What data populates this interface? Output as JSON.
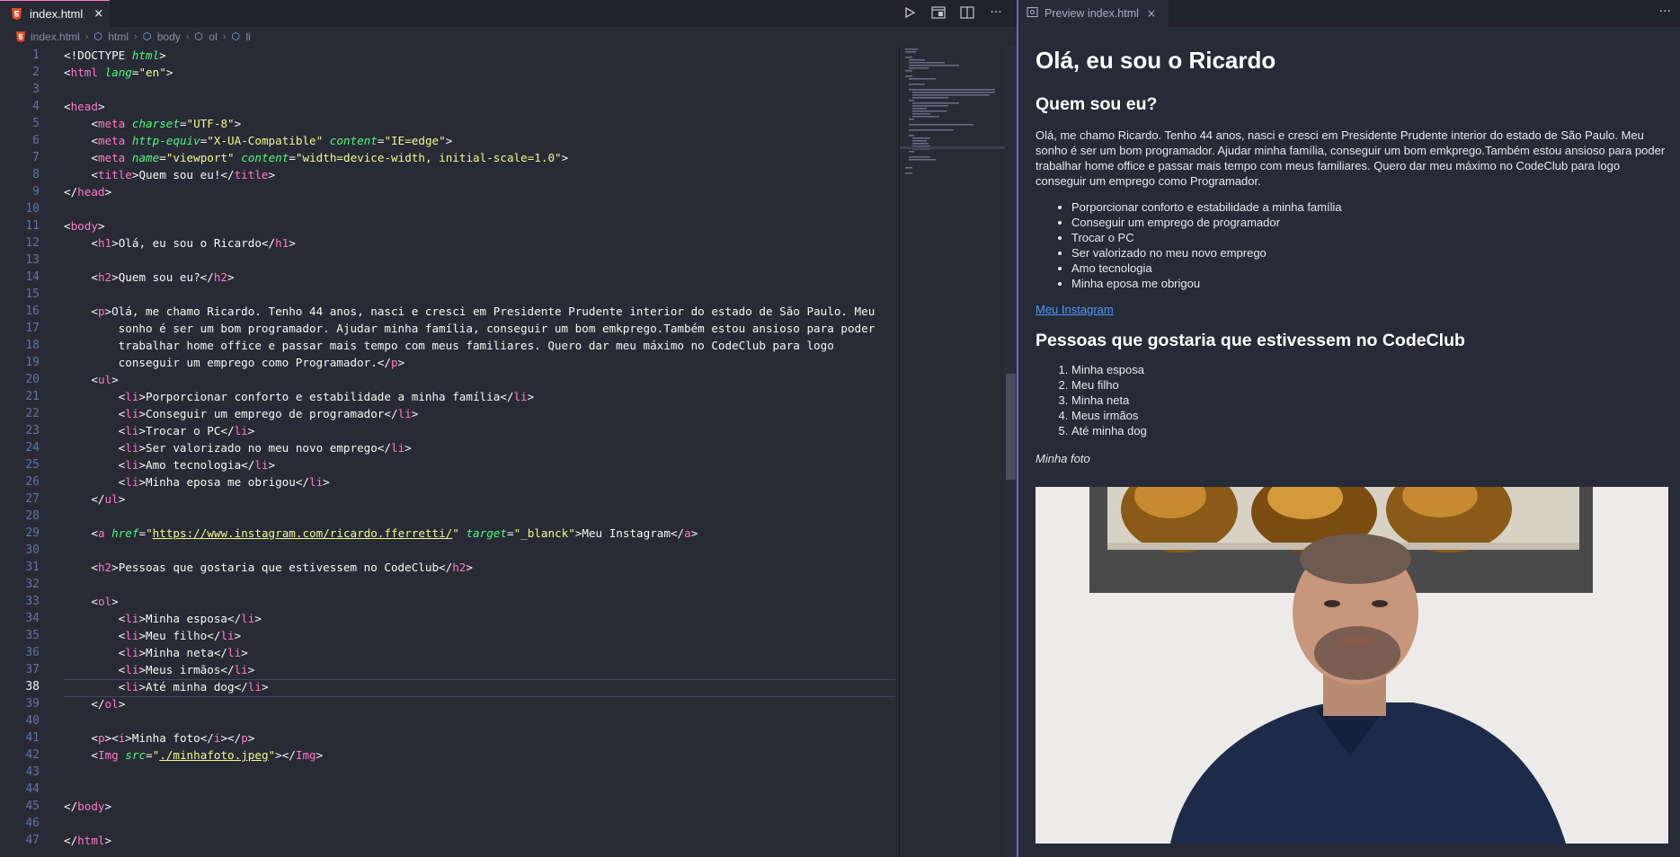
{
  "editor": {
    "tab_title": "index.html",
    "tab_close": "×",
    "toolbar_more": "···",
    "breadcrumb": [
      "index.html",
      "html",
      "body",
      "ol",
      "li"
    ],
    "line_numbers": [
      "1",
      "2",
      "3",
      "4",
      "5",
      "6",
      "7",
      "8",
      "9",
      "10",
      "11",
      "12",
      "13",
      "14",
      "15",
      "16",
      "17",
      "18",
      "19",
      "20",
      "21",
      "22",
      "23",
      "24",
      "25",
      "26",
      "27",
      "28",
      "29",
      "30",
      "31",
      "32",
      "33",
      "34",
      "35",
      "36",
      "37",
      "38",
      "39",
      "40",
      "41",
      "42",
      "43",
      "44",
      "45",
      "46",
      "47"
    ],
    "current_line": 38
  },
  "preview": {
    "tab_title": "Preview index.html",
    "tab_close": "×",
    "more": "···",
    "h1": "Olá, eu sou o Ricardo",
    "h2_about": "Quem sou eu?",
    "paragraph": "Olá, me chamo Ricardo. Tenho 44 anos, nasci e cresci em Presidente Prudente interior do estado de São Paulo. Meu sonho é ser um bom programador. Ajudar minha família, conseguir um bom emkprego.Também estou ansioso para poder trabalhar home office e passar mais tempo com meus familiares. Quero dar meu máximo no CodeClub para logo conseguir um emprego como Programador.",
    "ul_items": [
      "Porporcionar conforto e estabilidade a minha família",
      "Conseguir um emprego de programador",
      "Trocar o PC",
      "Ser valorizado no meu novo emprego",
      "Amo tecnologia",
      "Minha eposa me obrigou"
    ],
    "link_text": "Meu Instagram",
    "h2_people": "Pessoas que gostaria que estivessem no CodeClub",
    "ol_items": [
      "Minha esposa",
      "Meu filho",
      "Minha neta",
      "Meus irmãos",
      "Até minha dog"
    ],
    "photo_caption": "Minha foto"
  },
  "colors": {
    "editor_bg": "#282a36",
    "tag": "#ff79c6",
    "attribute": "#50fa7b",
    "string": "#f1fa8c",
    "link": "#4f9bf6"
  }
}
